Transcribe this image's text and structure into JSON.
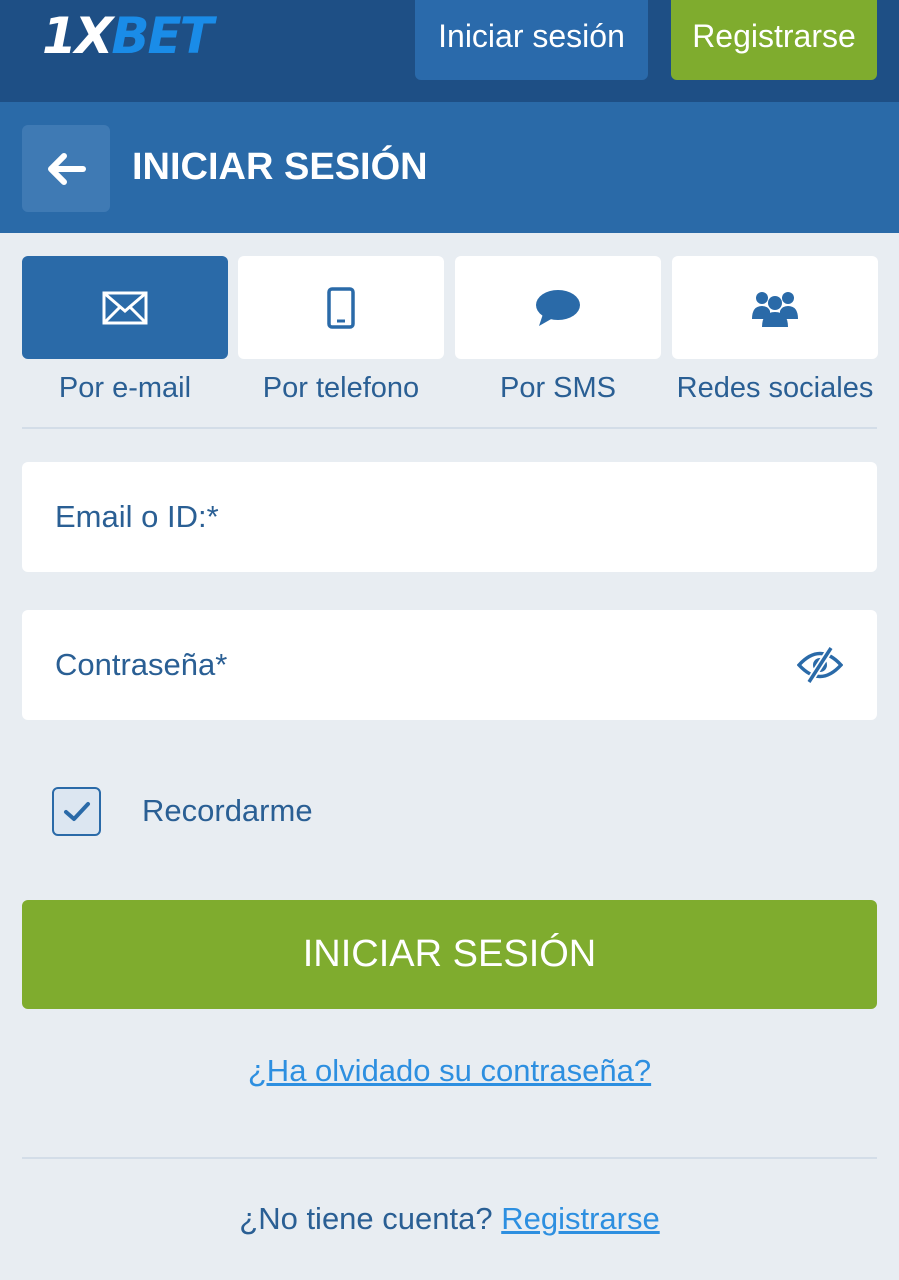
{
  "header": {
    "logo_text_1x": "1X",
    "logo_text_bet": "BET",
    "login_label": "Iniciar sesión",
    "register_label": "Registrarse"
  },
  "titlebar": {
    "back_icon": "arrow-left-icon",
    "title": "INICIAR SESIÓN"
  },
  "tabs": [
    {
      "label": "Por e-mail",
      "icon": "envelope-icon",
      "active": true
    },
    {
      "label": "Por telefono",
      "icon": "phone-icon",
      "active": false
    },
    {
      "label": "Por SMS",
      "icon": "chat-bubble-icon",
      "active": false
    },
    {
      "label": "Redes sociales",
      "icon": "users-icon",
      "active": false
    }
  ],
  "form": {
    "email_label": "Email o ID:*",
    "password_label": "Contraseña*",
    "password_toggle_icon": "eye-slash-icon",
    "remember_label": "Recordarme",
    "remember_checked": true,
    "submit_label": "INICIAR SESIÓN",
    "forgot_label": "¿Ha olvidado su contraseña?"
  },
  "footer": {
    "no_account_text": "¿No tiene cuenta?",
    "register_link": "Registrarse"
  },
  "colors": {
    "header_bg": "#1e4f85",
    "titlebar_bg": "#2a6aa8",
    "accent_green": "#7fac2e",
    "page_bg": "#e8edf2",
    "text_blue": "#2a5f94",
    "link_blue": "#2d8fe0"
  }
}
